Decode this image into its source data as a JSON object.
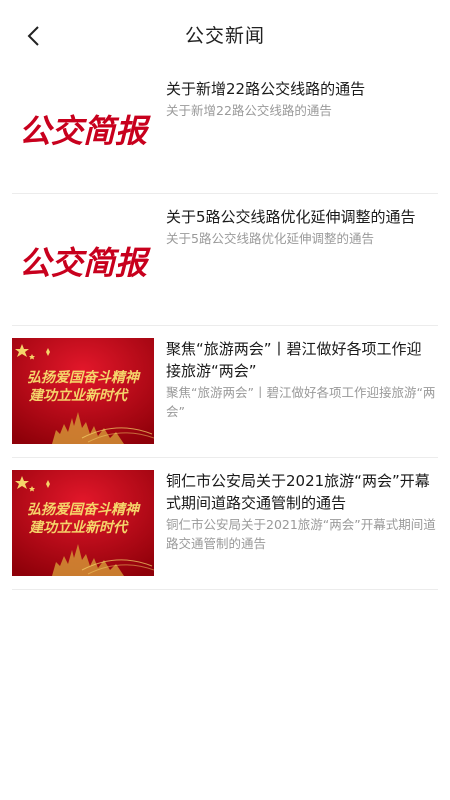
{
  "header": {
    "title": "公交新闻",
    "back_icon": "chevron-left-icon"
  },
  "colors": {
    "brand_red": "#c8001d",
    "banner_red": "#b3000f",
    "banner_gold": "#f5d46a",
    "text_primary": "#1a1a1a",
    "text_secondary": "#9a9a9a"
  },
  "news": [
    {
      "title": "关于新增22路公交线路的通告",
      "summary": "关于新增22路公交线路的通告",
      "thumb_type": "brand",
      "thumb_text": "公交简报"
    },
    {
      "title": "关于5路公交线路优化延伸调整的通告",
      "summary": "关于5路公交线路优化延伸调整的通告",
      "thumb_type": "brand",
      "thumb_text": "公交简报"
    },
    {
      "title": "聚焦“旅游两会”丨碧江做好各项工作迎接旅游“两会”",
      "summary": "聚焦“旅游两会”丨碧江做好各项工作迎接旅游“两会”",
      "thumb_type": "banner",
      "thumb_text": [
        "弘扬爱国奋斗精神",
        "建功立业新时代"
      ]
    },
    {
      "title": "铜仁市公安局关于2021旅游“两会”开幕式期间道路交通管制的通告",
      "summary": "铜仁市公安局关于2021旅游“两会”开幕式期间道路交通管制的通告",
      "thumb_type": "banner",
      "thumb_text": [
        "弘扬爱国奋斗精神",
        "建功立业新时代"
      ]
    }
  ]
}
